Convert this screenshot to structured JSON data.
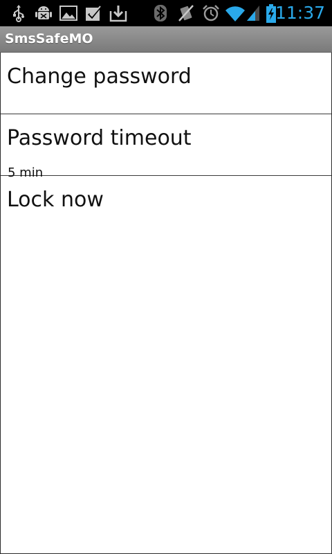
{
  "status_bar": {
    "time": "11:37",
    "icons": [
      "usb-icon",
      "android-debug-icon",
      "gallery-icon",
      "task-check-icon",
      "download-icon",
      "bluetooth-icon",
      "vibrate-off-icon",
      "alarm-icon",
      "wifi-icon",
      "signal-icon",
      "battery-charging-icon"
    ],
    "accent_color": "#2aa9ea"
  },
  "app": {
    "title": "SmsSafeMO"
  },
  "preferences": [
    {
      "label": "Change password",
      "summary": ""
    },
    {
      "label": "Password timeout",
      "summary": "5 min"
    },
    {
      "label": "Lock now",
      "summary": ""
    }
  ]
}
